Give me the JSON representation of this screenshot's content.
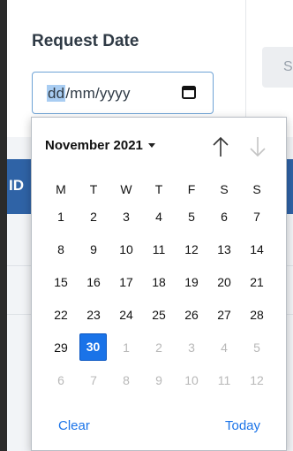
{
  "form": {
    "label": "Request Date",
    "date_day": "dd",
    "date_rest": "/mm/yyyy",
    "side_button": "S"
  },
  "table": {
    "header_id": "ID"
  },
  "calendar": {
    "month_label": "November 2021",
    "weekdays": [
      "M",
      "T",
      "W",
      "T",
      "F",
      "S",
      "S"
    ],
    "weeks": [
      [
        "1",
        "2",
        "3",
        "4",
        "5",
        "6",
        "7"
      ],
      [
        "8",
        "9",
        "10",
        "11",
        "12",
        "13",
        "14"
      ],
      [
        "15",
        "16",
        "17",
        "18",
        "19",
        "20",
        "21"
      ],
      [
        "22",
        "23",
        "24",
        "25",
        "26",
        "27",
        "28"
      ],
      [
        "29",
        "30",
        "1",
        "2",
        "3",
        "4",
        "5"
      ],
      [
        "6",
        "7",
        "8",
        "9",
        "10",
        "11",
        "12"
      ]
    ],
    "selected_day": "30",
    "clear_label": "Clear",
    "today_label": "Today"
  },
  "colors": {
    "accent": "#1a73e8",
    "header_bg": "#2f63a6"
  }
}
